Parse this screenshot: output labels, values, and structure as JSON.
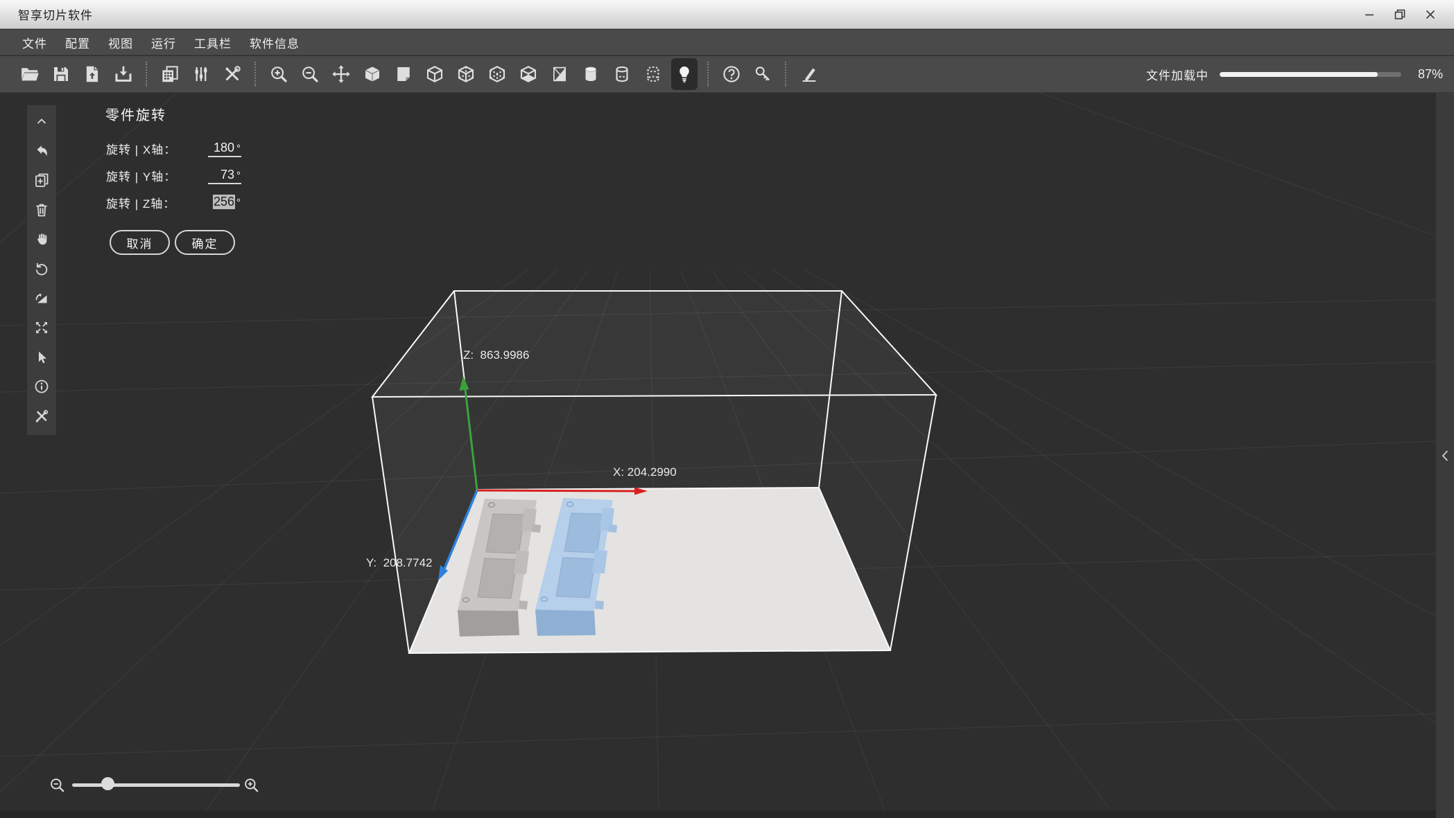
{
  "window": {
    "title": "智享切片软件"
  },
  "menu": {
    "items": [
      "文件",
      "配置",
      "视图",
      "运行",
      "工具栏",
      "软件信息"
    ]
  },
  "toolbar": {
    "loading_label": "文件加载中",
    "progress_value": 87,
    "progress_text": "87%",
    "icon_names": [
      "open-file",
      "save",
      "import-model",
      "export-download",
      "batch-copy",
      "parameter-sliders",
      "tools",
      "zoom-in",
      "zoom-out",
      "move",
      "view-box-solid",
      "view-sheet",
      "view-box-wireframe",
      "view-box-dashed",
      "view-box-hidden-edges",
      "view-box-base",
      "view-prism-cut",
      "view-cylinder-solid",
      "view-cylinder-wireframe",
      "view-cylinder-dashed",
      "light-toggle",
      "help",
      "license-key",
      "calibrate-pen"
    ],
    "active_icon": "light-toggle"
  },
  "sidebar": {
    "icon_names": [
      "collapse-up",
      "undo",
      "duplicate-part",
      "delete-part",
      "pan-hand",
      "rotate-part",
      "lay-flat",
      "scale-maximize",
      "select-cursor",
      "model-info",
      "repair-tools"
    ]
  },
  "panel": {
    "title": "零件旋转",
    "rows": [
      {
        "label": "旋转 | X轴：",
        "value": "180",
        "unit": "°",
        "selected": false
      },
      {
        "label": "旋转 | Y轴：",
        "value": "73",
        "unit": "°",
        "selected": false
      },
      {
        "label": "旋转 | Z轴：",
        "value": "256",
        "unit": "°",
        "selected": true
      }
    ],
    "cancel_label": "取消",
    "ok_label": "确定"
  },
  "viewport": {
    "axes": {
      "x_label": "X: 204.2990",
      "y_label": "Y:  208.7742",
      "z_label": "Z:  863.9986",
      "x_color": "#d91f1f",
      "y_color": "#2e80da",
      "z_color": "#3aa23d"
    },
    "build_plate_color": "#e4e3e1",
    "models": [
      {
        "name": "part-gray",
        "color": "#c8c6c3"
      },
      {
        "name": "part-blue",
        "color": "#b6cfea"
      }
    ]
  }
}
